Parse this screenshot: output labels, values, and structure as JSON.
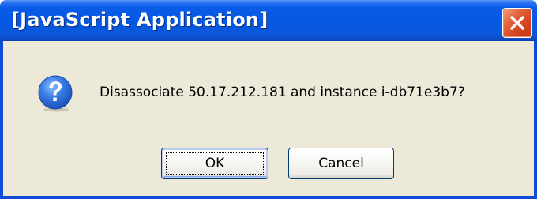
{
  "window": {
    "title": "[JavaScript Application]",
    "close_icon": "close-x-icon"
  },
  "dialog": {
    "icon": "question-icon",
    "message": "Disassociate 50.17.212.181 and instance i-db71e3b7?"
  },
  "buttons": {
    "ok_label": "OK",
    "cancel_label": "Cancel"
  },
  "colors": {
    "titlebar": "#0558e3",
    "frame": "#0f4bd6",
    "body": "#ece9d8",
    "close": "#d2411c",
    "icon": "#2b6fd8"
  }
}
